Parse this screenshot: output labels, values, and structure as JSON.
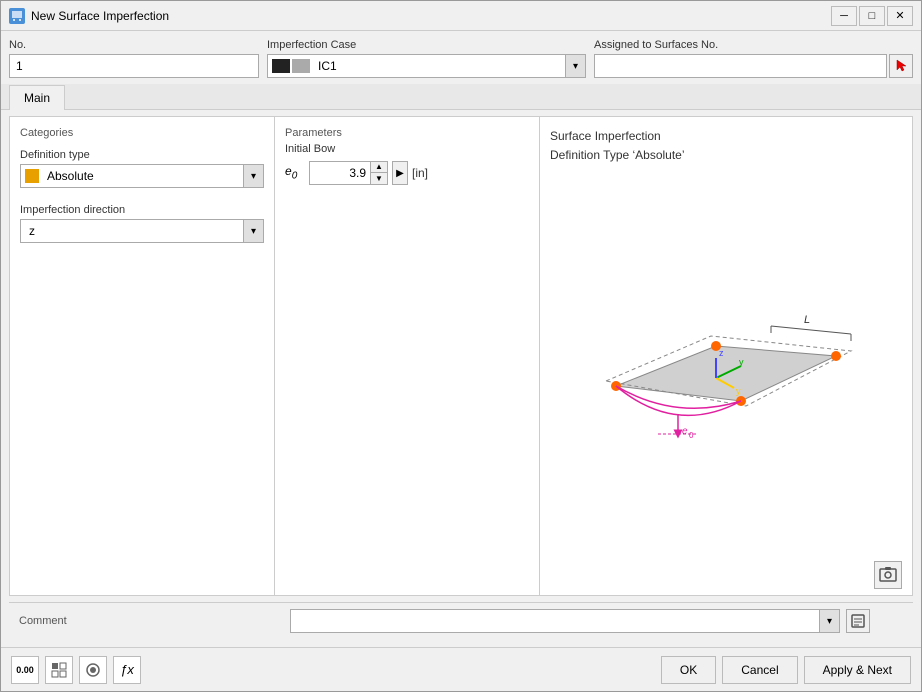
{
  "window": {
    "title": "New Surface Imperfection",
    "icon": "surface-imperfection-icon"
  },
  "titlebar": {
    "minimize_label": "─",
    "maximize_label": "□",
    "close_label": "✕"
  },
  "no_field": {
    "label": "No.",
    "value": "1"
  },
  "imperfection_case": {
    "label": "Imperfection Case",
    "color": "#444444",
    "color2": "#aaaaaa",
    "value": "IC1"
  },
  "assigned": {
    "label": "Assigned to Surfaces No.",
    "value": ""
  },
  "tabs": [
    {
      "label": "Main",
      "active": true
    }
  ],
  "categories": {
    "label": "Categories",
    "definition_type": {
      "label": "Definition type",
      "color": "#e8a000",
      "value": "Absolute"
    },
    "imperfection_direction": {
      "label": "Imperfection direction",
      "value": "z"
    }
  },
  "parameters": {
    "label": "Parameters",
    "initial_bow": {
      "label": "Initial Bow",
      "key": "e₀",
      "value": "3.9",
      "unit": "[in]"
    }
  },
  "description": {
    "line1": "Surface Imperfection",
    "line2": "Definition Type ‘Absolute’"
  },
  "comment": {
    "label": "Comment",
    "value": "",
    "placeholder": ""
  },
  "footer_tools": [
    {
      "name": "coordinates-tool",
      "icon": "0.00"
    },
    {
      "name": "view-tool",
      "icon": "⊞"
    },
    {
      "name": "display-tool",
      "icon": "◉"
    },
    {
      "name": "formula-tool",
      "icon": "ƒx"
    }
  ],
  "buttons": {
    "ok": "OK",
    "cancel": "Cancel",
    "apply_next": "Apply & Next"
  }
}
